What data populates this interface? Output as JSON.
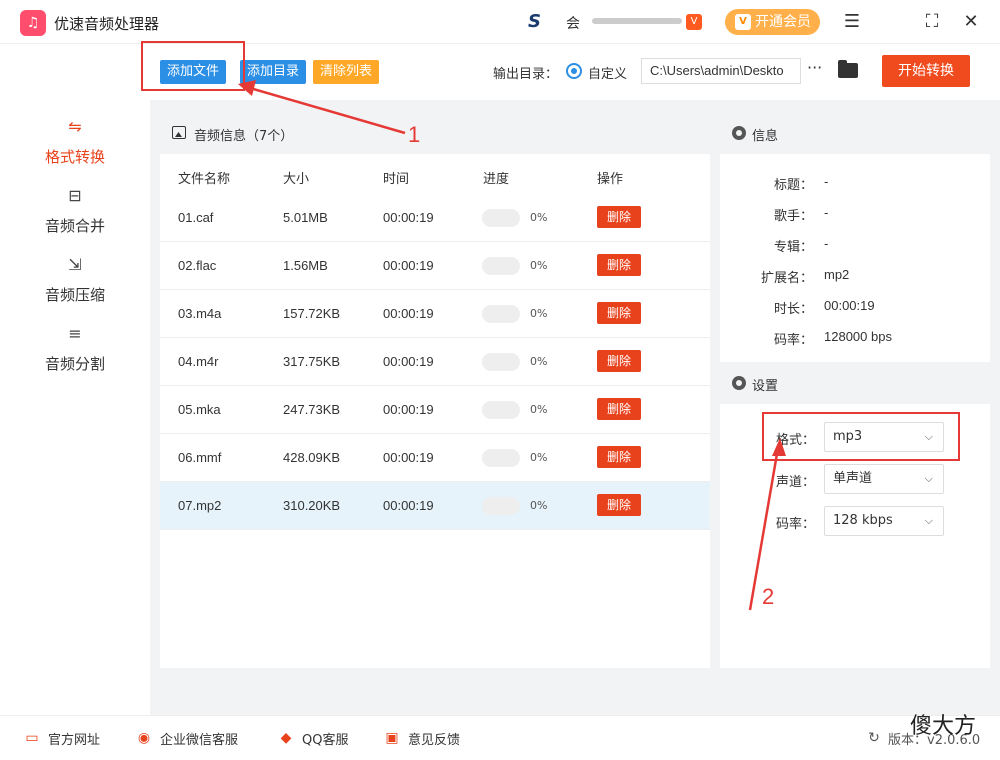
{
  "app": {
    "title": "优速音频处理器",
    "user_name_prefix": "会",
    "vip_badge": "V",
    "vip_button": "开通会员",
    "vip_icon": "V"
  },
  "window": {
    "menu_icon": "☰",
    "max_icon": "⛶",
    "close_icon": "✕"
  },
  "toolbar": {
    "add_file": "添加文件",
    "add_dir": "添加目录",
    "clear_list": "清除列表",
    "output_label": "输出目录：",
    "radio_label": "自定义",
    "path_value": "C:\\Users\\admin\\Deskto",
    "more": "···",
    "start": "开始转换"
  },
  "sidebar": {
    "items": [
      {
        "label": "格式转换",
        "icon": "⇋",
        "active": true
      },
      {
        "label": "音频合并",
        "icon": "⊟"
      },
      {
        "label": "音频压缩",
        "icon": "⇲"
      },
      {
        "label": "音频分割",
        "icon": "≡"
      }
    ]
  },
  "file_list": {
    "title": "音频信息（7个）",
    "columns": [
      "文件名称",
      "大小",
      "时间",
      "进度",
      "操作"
    ],
    "delete_label": "删除",
    "rows": [
      {
        "name": "01.caf",
        "size": "5.01MB",
        "time": "00:00:19",
        "progress": "0%"
      },
      {
        "name": "02.flac",
        "size": "1.56MB",
        "time": "00:00:19",
        "progress": "0%"
      },
      {
        "name": "03.m4a",
        "size": "157.72KB",
        "time": "00:00:19",
        "progress": "0%"
      },
      {
        "name": "04.m4r",
        "size": "317.75KB",
        "time": "00:00:19",
        "progress": "0%"
      },
      {
        "name": "05.mka",
        "size": "247.73KB",
        "time": "00:00:19",
        "progress": "0%"
      },
      {
        "name": "06.mmf",
        "size": "428.09KB",
        "time": "00:00:19",
        "progress": "0%"
      },
      {
        "name": "07.mp2",
        "size": "310.20KB",
        "time": "00:00:19",
        "progress": "0%",
        "selected": true
      }
    ]
  },
  "info": {
    "title": "信息",
    "fields": [
      {
        "label": "标题：",
        "value": "-"
      },
      {
        "label": "歌手：",
        "value": "-"
      },
      {
        "label": "专辑：",
        "value": "-"
      },
      {
        "label": "扩展名：",
        "value": "mp2"
      },
      {
        "label": "时长：",
        "value": "00:00:19"
      },
      {
        "label": "码率：",
        "value": "128000 bps"
      }
    ]
  },
  "settings": {
    "title": "设置",
    "format_label": "格式：",
    "format_value": "mp3",
    "channel_label": "声道：",
    "channel_value": "单声道",
    "bitrate_label": "码率：",
    "bitrate_value": "128 kbps"
  },
  "annotations": {
    "num1": "1",
    "num2": "2",
    "color": "#e53935"
  },
  "footer": {
    "website": "官方网址",
    "wechat": "企业微信客服",
    "qq": "QQ客服",
    "feedback": "意见反馈",
    "version": "版本：v2.0.6.0"
  },
  "watermark": "傻大方",
  "colors": {
    "accent": "#e8421c",
    "primary": "#2b8fe5",
    "clear": "#ffa726",
    "vip": "#ffb04a"
  }
}
